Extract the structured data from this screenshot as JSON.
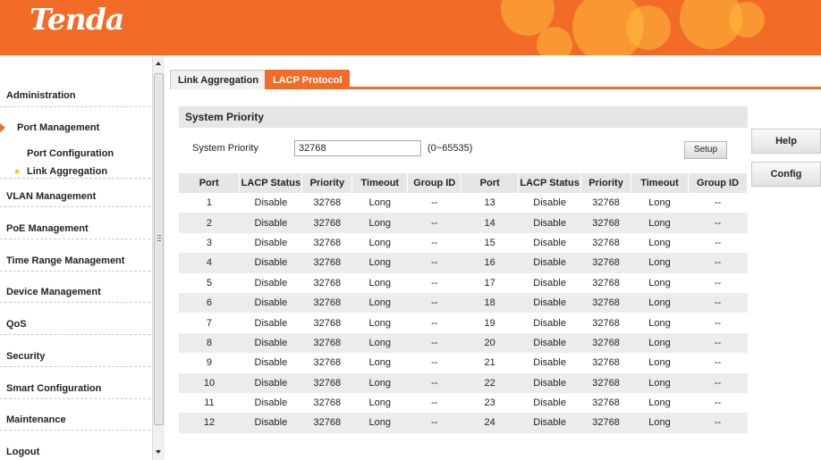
{
  "header": {
    "logo": "Tenda"
  },
  "sidebar": {
    "items": [
      {
        "label": "Administration"
      },
      {
        "label": "Port Management"
      },
      {
        "label": "VLAN Management"
      },
      {
        "label": "PoE Management"
      },
      {
        "label": "Time Range Management"
      },
      {
        "label": "Device Management"
      },
      {
        "label": "QoS"
      },
      {
        "label": "Security"
      },
      {
        "label": "Smart Configuration"
      },
      {
        "label": "Maintenance"
      },
      {
        "label": "Logout"
      }
    ],
    "sub_items": [
      {
        "label": "Port Configuration"
      },
      {
        "label": "Link Aggregation"
      }
    ]
  },
  "tabs": [
    {
      "label": "Link Aggregation"
    },
    {
      "label": "LACP Protocol"
    }
  ],
  "section": {
    "title": "System Priority"
  },
  "system_priority": {
    "label": "System Priority",
    "value": "32768",
    "range": "(0~65535)",
    "setup_label": "Setup"
  },
  "side_buttons": {
    "help": "Help",
    "config": "Config"
  },
  "table": {
    "headers": [
      "Port",
      "LACP Status",
      "Priority",
      "Timeout",
      "Group ID",
      "Port",
      "LACP Status",
      "Priority",
      "Timeout",
      "Group ID"
    ],
    "rows": [
      [
        "1",
        "Disable",
        "32768",
        "Long",
        "--",
        "13",
        "Disable",
        "32768",
        "Long",
        "--"
      ],
      [
        "2",
        "Disable",
        "32768",
        "Long",
        "--",
        "14",
        "Disable",
        "32768",
        "Long",
        "--"
      ],
      [
        "3",
        "Disable",
        "32768",
        "Long",
        "--",
        "15",
        "Disable",
        "32768",
        "Long",
        "--"
      ],
      [
        "4",
        "Disable",
        "32768",
        "Long",
        "--",
        "16",
        "Disable",
        "32768",
        "Long",
        "--"
      ],
      [
        "5",
        "Disable",
        "32768",
        "Long",
        "--",
        "17",
        "Disable",
        "32768",
        "Long",
        "--"
      ],
      [
        "6",
        "Disable",
        "32768",
        "Long",
        "--",
        "18",
        "Disable",
        "32768",
        "Long",
        "--"
      ],
      [
        "7",
        "Disable",
        "32768",
        "Long",
        "--",
        "19",
        "Disable",
        "32768",
        "Long",
        "--"
      ],
      [
        "8",
        "Disable",
        "32768",
        "Long",
        "--",
        "20",
        "Disable",
        "32768",
        "Long",
        "--"
      ],
      [
        "9",
        "Disable",
        "32768",
        "Long",
        "--",
        "21",
        "Disable",
        "32768",
        "Long",
        "--"
      ],
      [
        "10",
        "Disable",
        "32768",
        "Long",
        "--",
        "22",
        "Disable",
        "32768",
        "Long",
        "--"
      ],
      [
        "11",
        "Disable",
        "32768",
        "Long",
        "--",
        "23",
        "Disable",
        "32768",
        "Long",
        "--"
      ],
      [
        "12",
        "Disable",
        "32768",
        "Long",
        "--",
        "24",
        "Disable",
        "32768",
        "Long",
        "--"
      ]
    ]
  },
  "colors": {
    "accent": "#f26b27",
    "active_dot": "#f5c400",
    "header_gray": "#e6e6e6"
  }
}
